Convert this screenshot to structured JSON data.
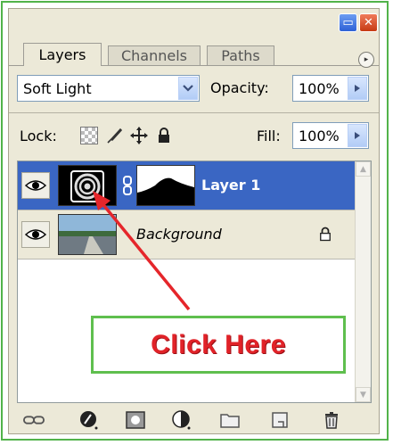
{
  "panel": {
    "tabs": [
      {
        "label": "Layers",
        "active": true
      },
      {
        "label": "Channels",
        "active": false
      },
      {
        "label": "Paths",
        "active": false
      }
    ],
    "window_buttons": {
      "minimize": "▭",
      "close": "✕"
    },
    "menu_icon": "▸"
  },
  "controls": {
    "blend_mode": "Soft Light",
    "opacity_label": "Opacity:",
    "opacity_value": "100%",
    "lock_label": "Lock:",
    "fill_label": "Fill:",
    "fill_value": "100%"
  },
  "layers": [
    {
      "name": "Layer 1",
      "selected": true,
      "visible": true
    },
    {
      "name": "Background",
      "selected": false,
      "visible": true,
      "locked": true
    }
  ],
  "callout": {
    "text": "Click Here"
  },
  "icons": {
    "lock_icons": [
      "lock-transparent-pixels-icon",
      "lock-image-pixels-icon",
      "lock-position-icon",
      "lock-all-icon"
    ],
    "bottom_icons": [
      "link-layers-icon",
      "layer-style-icon",
      "add-mask-icon",
      "adjustment-layer-icon",
      "new-group-icon",
      "new-layer-icon",
      "delete-layer-icon"
    ]
  },
  "colors": {
    "selected_layer": "#3a66c3",
    "frame_border": "#52b34a",
    "callout_text": "#e12228",
    "arrow": "#e5262b"
  }
}
